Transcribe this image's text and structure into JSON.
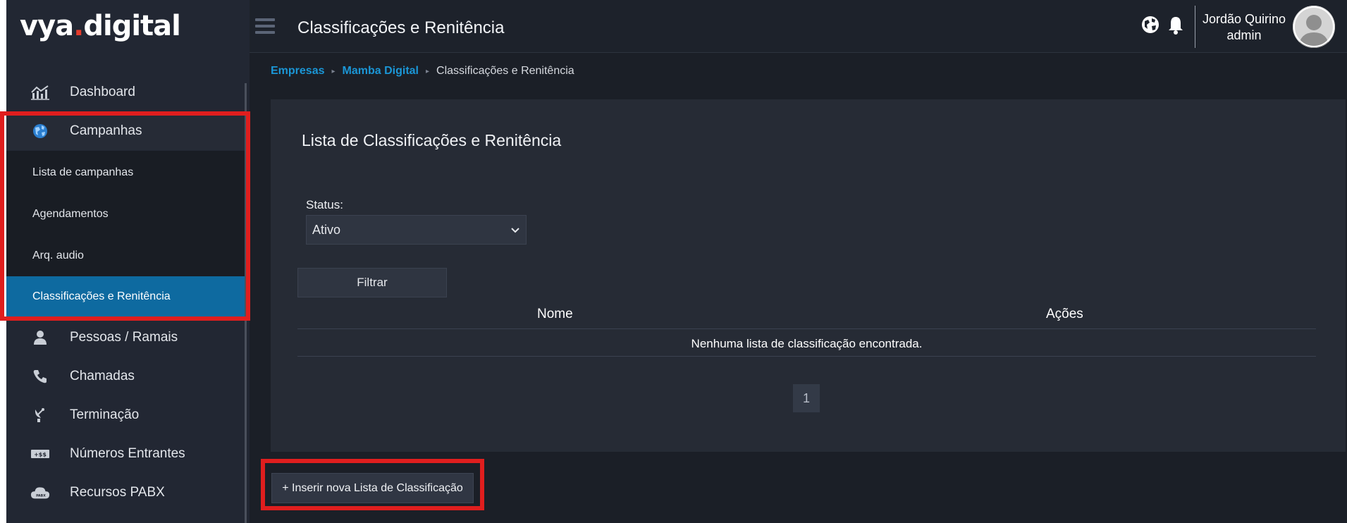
{
  "logo": {
    "part1": "vya",
    "dot": ".",
    "part2": "digital"
  },
  "sidebar": {
    "items": [
      {
        "label": "Dashboard",
        "icon": "chart-icon"
      },
      {
        "label": "Campanhas",
        "icon": "globe-icon"
      },
      {
        "label": "Pessoas / Ramais",
        "icon": "person-icon"
      },
      {
        "label": "Chamadas",
        "icon": "phone-icon"
      },
      {
        "label": "Terminação",
        "icon": "satellite-icon"
      },
      {
        "label": "Números Entrantes",
        "icon": "money-icon"
      },
      {
        "label": "Recursos PABX",
        "icon": "cloud-icon"
      }
    ],
    "subitems": [
      {
        "label": "Lista de campanhas"
      },
      {
        "label": "Agendamentos"
      },
      {
        "label": "Arq. audio"
      },
      {
        "label": "Classificações e Renitência",
        "active": true
      }
    ]
  },
  "header": {
    "title": "Classificações e Renitência",
    "user_name": "Jordão Quirino",
    "user_role": "admin"
  },
  "breadcrumb": {
    "items": [
      "Empresas",
      "Mamba Digital"
    ],
    "current": "Classificações e Renitência"
  },
  "card": {
    "title": "Lista de Classificações e Renitência",
    "status_label": "Status:",
    "status_value": "Ativo",
    "filter_label": "Filtrar",
    "columns": [
      "Nome",
      "Ações"
    ],
    "empty_message": "Nenhuma lista de classificação encontrada.",
    "page": "1"
  },
  "actions": {
    "insert_label": "+ Inserir nova Lista de Classificação"
  },
  "colors": {
    "accent": "#0e6aa0",
    "link": "#1b96d6",
    "highlight": "#e01e1e",
    "logo_dot": "#e53b2b"
  }
}
